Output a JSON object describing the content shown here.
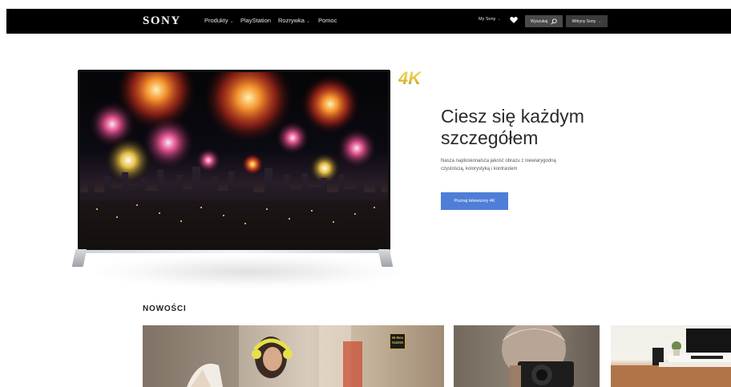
{
  "header": {
    "logo": "SONY",
    "nav": [
      {
        "label": "Produkty",
        "has_dropdown": true
      },
      {
        "label": "PlayStation",
        "has_dropdown": false
      },
      {
        "label": "Rozrywka",
        "has_dropdown": true
      },
      {
        "label": "Pomoc",
        "has_dropdown": false
      }
    ],
    "my_sony": "My Sony",
    "search_label": "Wyszukaj",
    "sites_label": "Witryny Sony",
    "icons": [
      "chevron-down-icon",
      "heart-icon",
      "search-icon"
    ]
  },
  "hero": {
    "badge": "4K",
    "title": "Ciesz się każdym szczegółem",
    "description": "Nasza najdoskonalsza jakość obrazu z niewiarygodną czystością, kolorystyką i kontrastem",
    "cta_label": "Poznaj telewizory 4K",
    "cta_color": "#4f7ed8"
  },
  "news": {
    "title": "NOWOŚCI",
    "tiles": [
      {
        "subject": "woman-with-yellow-headphones",
        "badge": "Hi-Res AUDIO"
      },
      {
        "subject": "man-with-camera"
      },
      {
        "subject": "tv-with-soundbar"
      }
    ]
  },
  "colors": {
    "topbar": "#000000",
    "accent_blue": "#4f7ed8",
    "gold_4k": "#e3c23a"
  }
}
